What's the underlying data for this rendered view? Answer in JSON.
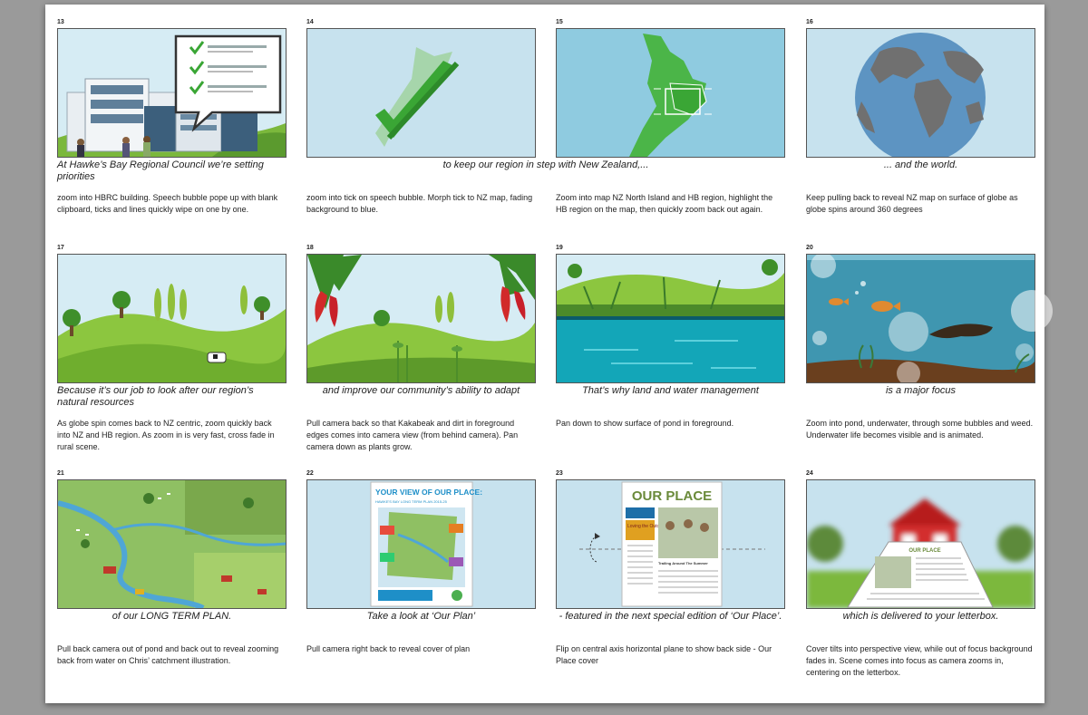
{
  "panels": [
    {
      "number": "13",
      "caption": "At Hawke’s Bay Regional Council we’re setting priorities",
      "description": "zoom into HBRC building. Speech bubble pope up with blank clipboard, ticks and lines quickly wipe on one by one.",
      "caption_align": "left"
    },
    {
      "number": "14",
      "caption": "to keep our region in step with New Zealand,...",
      "description": "zoom into tick on speech bubble. Morph tick to NZ map, fading background to blue."
    },
    {
      "number": "15",
      "caption": "",
      "description": "Zoom into map NZ North Island and HB region, highlight the HB region on the map, then quickly zoom back out again."
    },
    {
      "number": "16",
      "caption": "... and the world.",
      "description": "Keep pulling back to reveal NZ map on surface of globe as globe spins around 360 degrees"
    },
    {
      "number": "17",
      "caption": "Because it’s our job to look after our region’s natural resources",
      "description": "As globe spin comes back to NZ centric, zoom quickly back into NZ and HB region. As zoom in is very fast, cross fade in rural scene.",
      "caption_align": "left"
    },
    {
      "number": "18",
      "caption": "and improve our community’s ability to adapt",
      "description": "Pull camera back so that Kakabeak and dirt in foreground edges comes into camera view (from behind camera). Pan camera down as plants grow."
    },
    {
      "number": "19",
      "caption": "That’s why land and water management",
      "description": "Pan down to show surface of pond in foreground."
    },
    {
      "number": "20",
      "caption": "is a major focus",
      "description": "Zoom into pond, underwater, through some bubbles and weed. Underwater life becomes visible and is animated."
    },
    {
      "number": "21",
      "caption": "of our LONG TERM PLAN.",
      "description": "Pull back camera out of pond and back out to reveal zooming back from water on Chris’ catchment illustration."
    },
    {
      "number": "22",
      "caption": "Take a look at ‘Our Plan’",
      "description": "Pull camera right back to reveal cover of plan"
    },
    {
      "number": "23",
      "caption": "- featured in the next special edition of ‘Our Place’.",
      "description": "Flip on central axis horizontal plane to show back side - Our Place cover"
    },
    {
      "number": "24",
      "caption": "which is delivered to your letterbox.",
      "description": "Cover tilts into perspective view, while out of focus background fades in. Scene comes into focus as camera zooms in, centering on the letterbox."
    }
  ],
  "artwork": {
    "plan_cover_title": "YOUR VIEW OF OUR PLACE:",
    "plan_cover_subtitle": "HAWKE'S BAY LONG TERM PLAN 2015-25",
    "our_place_title": "OUR PLACE",
    "our_place_headline": "Loving the Outdoors!",
    "our_place_story": "Trailing Around The Summer",
    "letterbox_title": "OUR PLACE"
  }
}
